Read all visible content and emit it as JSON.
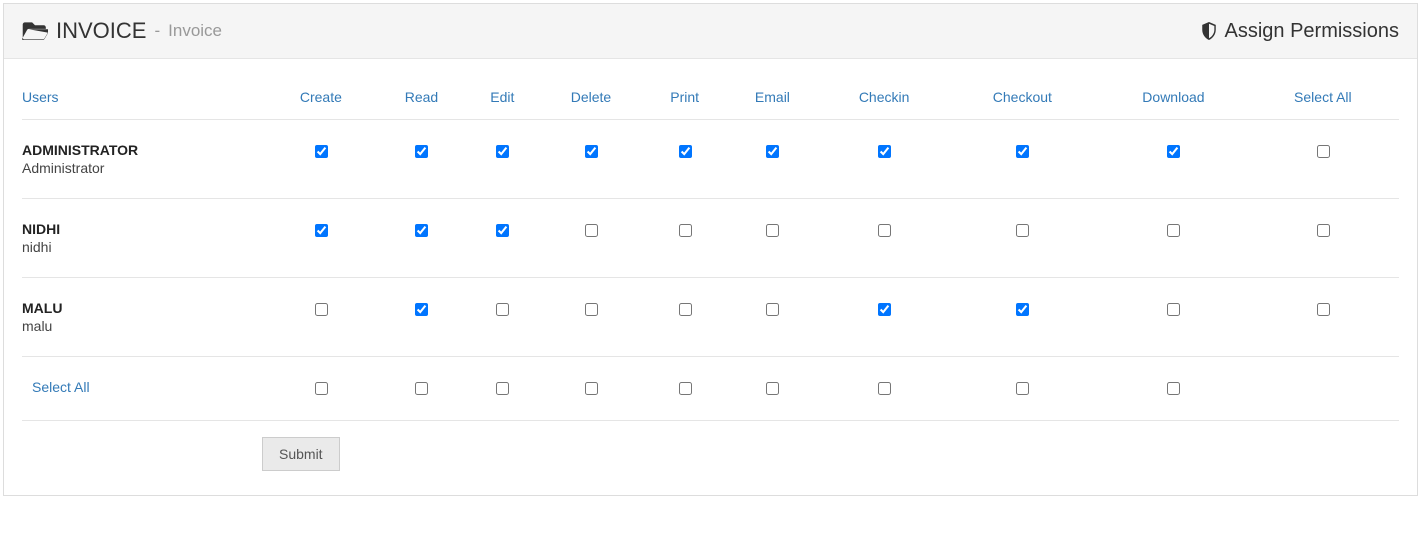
{
  "header": {
    "title_upper": "INVOICE",
    "title_sep": " - ",
    "title_sub": "Invoice",
    "assign_label": "Assign Permissions"
  },
  "columns": [
    "Users",
    "Create",
    "Read",
    "Edit",
    "Delete",
    "Print",
    "Email",
    "Checkin",
    "Checkout",
    "Download",
    "Select All"
  ],
  "rows": [
    {
      "name": "ADMINISTRATOR",
      "sub": "Administrator",
      "checks": {
        "Create": true,
        "Read": true,
        "Edit": true,
        "Delete": true,
        "Print": true,
        "Email": true,
        "Checkin": true,
        "Checkout": true,
        "Download": true,
        "Select All": false
      }
    },
    {
      "name": "NIDHI",
      "sub": "nidhi",
      "checks": {
        "Create": true,
        "Read": true,
        "Edit": true,
        "Delete": false,
        "Print": false,
        "Email": false,
        "Checkin": false,
        "Checkout": false,
        "Download": false,
        "Select All": false
      }
    },
    {
      "name": "MALU",
      "sub": "malu",
      "checks": {
        "Create": false,
        "Read": true,
        "Edit": false,
        "Delete": false,
        "Print": false,
        "Email": false,
        "Checkin": true,
        "Checkout": true,
        "Download": false,
        "Select All": false
      }
    }
  ],
  "footer_row": {
    "label": "Select All",
    "checks": {
      "Create": false,
      "Read": false,
      "Edit": false,
      "Delete": false,
      "Print": false,
      "Email": false,
      "Checkin": false,
      "Checkout": false,
      "Download": false
    }
  },
  "submit_label": "Submit"
}
